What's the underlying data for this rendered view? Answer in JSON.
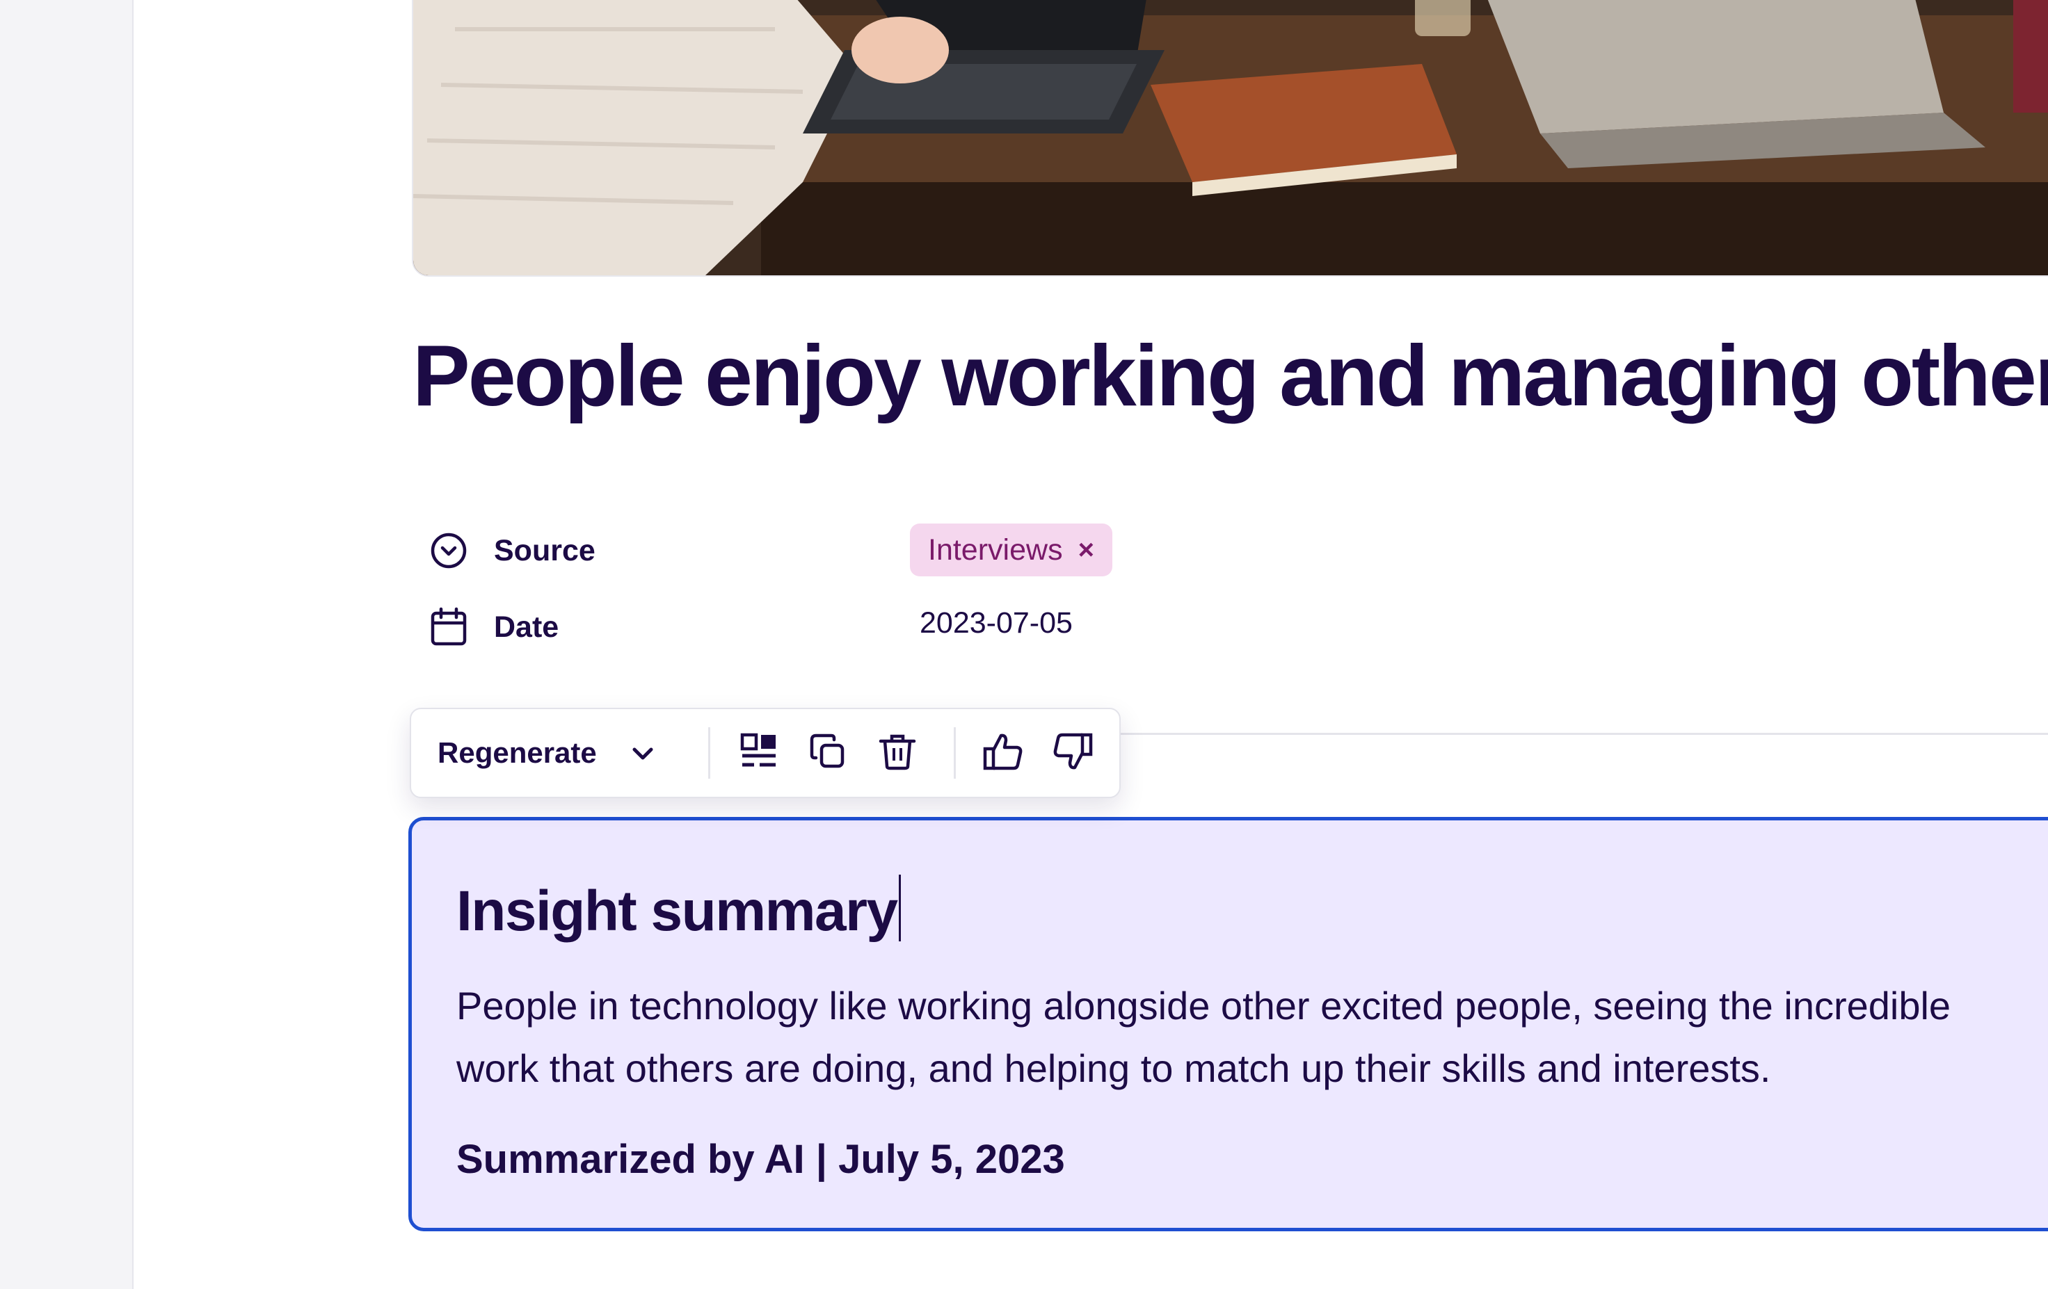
{
  "page": {
    "title": "People enjoy working and managing others"
  },
  "properties": {
    "source": {
      "label": "Source",
      "tag": "Interviews",
      "tag_remove": "×",
      "icon": "chevron-circle-down-icon"
    },
    "date": {
      "label": "Date",
      "value": "2023-07-05",
      "icon": "calendar-icon"
    }
  },
  "toolbar": {
    "regenerate_label": "Regenerate",
    "buttons": [
      {
        "icon": "layout-icon"
      },
      {
        "icon": "copy-icon"
      },
      {
        "icon": "trash-icon"
      },
      {
        "icon": "thumbs-up-icon"
      },
      {
        "icon": "thumbs-down-icon"
      }
    ]
  },
  "summary": {
    "title": "Insight summary",
    "body_lines": [
      "People in technology like working alongside other excited people, seeing the incredible",
      "work that others are doing, and helping to match up their skills and interests."
    ],
    "meta": "Summarized by AI | July 5, 2023"
  },
  "colors": {
    "text": "#1c0b45",
    "tag_bg": "#f5d7ee",
    "tag_text": "#7a1a6a",
    "summary_bg": "#ede8ff",
    "summary_border": "#1f4fd1"
  }
}
